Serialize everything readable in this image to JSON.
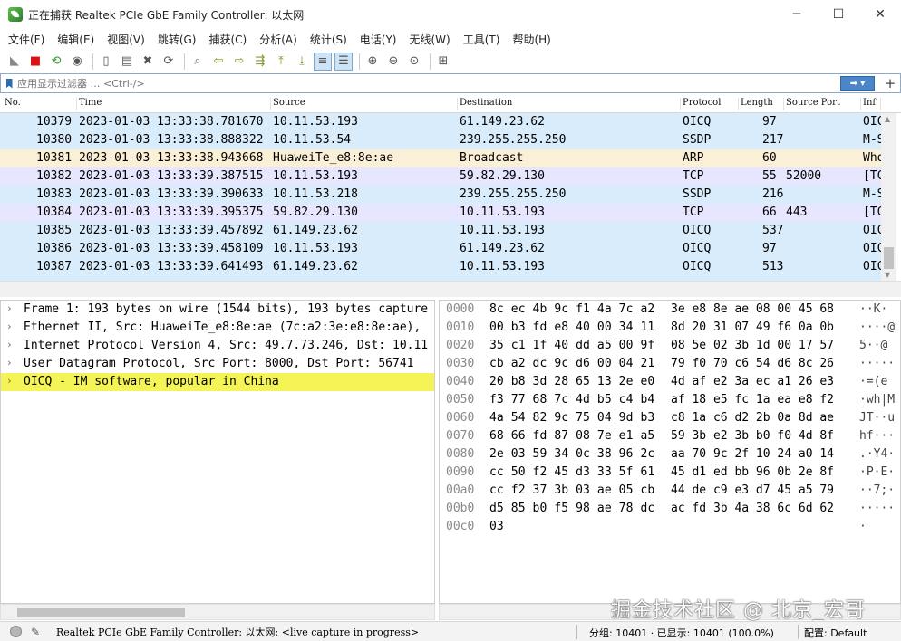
{
  "window": {
    "title": "正在捕获 Realtek PCIe GbE Family Controller: 以太网",
    "minimize": "─",
    "maximize": "☐",
    "close": "✕"
  },
  "menu": [
    "文件(F)",
    "编辑(E)",
    "视图(V)",
    "跳转(G)",
    "捕获(C)",
    "分析(A)",
    "统计(S)",
    "电话(Y)",
    "无线(W)",
    "工具(T)",
    "帮助(H)"
  ],
  "toolbar": {
    "icons": [
      "shark-fin-icon",
      "stop-icon",
      "restart-icon",
      "options-icon",
      "open-icon",
      "save-icon",
      "close-file-icon",
      "reload-icon",
      "find-icon",
      "back-icon",
      "forward-icon",
      "goto-icon",
      "first-icon",
      "last-icon",
      "autoscroll-icon",
      "colorize-icon",
      "zoom-in-icon",
      "zoom-out-icon",
      "zoom-normal-icon",
      "resize-columns-icon"
    ]
  },
  "filter": {
    "placeholder": "应用显示过滤器 … <Ctrl-/>",
    "apply": "➡ ▾",
    "add": "+"
  },
  "columns": [
    "No.",
    "Time",
    "Source",
    "Destination",
    "Protocol",
    "Length",
    "Source Port",
    "Inf"
  ],
  "packets": [
    {
      "no": "10379",
      "time": "2023-01-03 13:33:38.781670",
      "src": "10.11.53.193",
      "dst": "61.149.23.62",
      "proto": "OICQ",
      "len": "97",
      "sport": "",
      "info": "OIC",
      "color": "#d9ecfb"
    },
    {
      "no": "10380",
      "time": "2023-01-03 13:33:38.888322",
      "src": "10.11.53.54",
      "dst": "239.255.255.250",
      "proto": "SSDP",
      "len": "217",
      "sport": "",
      "info": "M-S",
      "color": "#d9ecfb"
    },
    {
      "no": "10381",
      "time": "2023-01-03 13:33:38.943668",
      "src": "HuaweiTe_e8:8e:ae",
      "dst": "Broadcast",
      "proto": "ARP",
      "len": "60",
      "sport": "",
      "info": "Who",
      "color": "#faf0d7"
    },
    {
      "no": "10382",
      "time": "2023-01-03 13:33:39.387515",
      "src": "10.11.53.193",
      "dst": "59.82.29.130",
      "proto": "TCP",
      "len": "55",
      "sport": "52000",
      "info": "[TC",
      "color": "#e7e6ff"
    },
    {
      "no": "10383",
      "time": "2023-01-03 13:33:39.390633",
      "src": "10.11.53.218",
      "dst": "239.255.255.250",
      "proto": "SSDP",
      "len": "216",
      "sport": "",
      "info": "M-S",
      "color": "#d9ecfb"
    },
    {
      "no": "10384",
      "time": "2023-01-03 13:33:39.395375",
      "src": "59.82.29.130",
      "dst": "10.11.53.193",
      "proto": "TCP",
      "len": "66",
      "sport": "443",
      "info": "[TC",
      "color": "#e7e6ff"
    },
    {
      "no": "10385",
      "time": "2023-01-03 13:33:39.457892",
      "src": "61.149.23.62",
      "dst": "10.11.53.193",
      "proto": "OICQ",
      "len": "537",
      "sport": "",
      "info": "OIC",
      "color": "#d9ecfb"
    },
    {
      "no": "10386",
      "time": "2023-01-03 13:33:39.458109",
      "src": "10.11.53.193",
      "dst": "61.149.23.62",
      "proto": "OICQ",
      "len": "97",
      "sport": "",
      "info": "OIC",
      "color": "#d9ecfb"
    },
    {
      "no": "10387",
      "time": "2023-01-03 13:33:39.641493",
      "src": "61.149.23.62",
      "dst": "10.11.53.193",
      "proto": "OICQ",
      "len": "513",
      "sport": "",
      "info": "OIC",
      "color": "#d9ecfb"
    }
  ],
  "details": [
    {
      "text": "Frame 1: 193 bytes on wire (1544 bits), 193 bytes capture",
      "hl": false
    },
    {
      "text": "Ethernet II, Src: HuaweiTe_e8:8e:ae (7c:a2:3e:e8:8e:ae),",
      "hl": false
    },
    {
      "text": "Internet Protocol Version 4, Src: 49.7.73.246, Dst: 10.11",
      "hl": false
    },
    {
      "text": "User Datagram Protocol, Src Port: 8000, Dst Port: 56741",
      "hl": false
    },
    {
      "text": "OICQ - IM software, popular in China",
      "hl": true
    }
  ],
  "hex": [
    {
      "off": "0000",
      "a": "8c ec 4b 9c f1 4a 7c a2",
      "b": "3e e8 8e ae 08 00 45 68",
      "asc": "··K·"
    },
    {
      "off": "0010",
      "a": "00 b3 fd e8 40 00 34 11",
      "b": "8d 20 31 07 49 f6 0a 0b",
      "asc": "····@"
    },
    {
      "off": "0020",
      "a": "35 c1 1f 40 dd a5 00 9f",
      "b": "08 5e 02 3b 1d 00 17 57",
      "asc": "5··@"
    },
    {
      "off": "0030",
      "a": "cb a2 dc 9c d6 00 04 21",
      "b": "79 f0 70 c6 54 d6 8c 26",
      "asc": "·····"
    },
    {
      "off": "0040",
      "a": "20 b8 3d 28 65 13 2e e0",
      "b": "4d af e2 3a ec a1 26 e3",
      "asc": " ·=(e"
    },
    {
      "off": "0050",
      "a": "f3 77 68 7c 4d b5 c4 b4",
      "b": "af 18 e5 fc 1a ea e8 f2",
      "asc": "·wh|M"
    },
    {
      "off": "0060",
      "a": "4a 54 82 9c 75 04 9d b3",
      "b": "c8 1a c6 d2 2b 0a 8d ae",
      "asc": "JT··u"
    },
    {
      "off": "0070",
      "a": "68 66 fd 87 08 7e e1 a5",
      "b": "59 3b e2 3b b0 f0 4d 8f",
      "asc": "hf···"
    },
    {
      "off": "0080",
      "a": "2e 03 59 34 0c 38 96 2c",
      "b": "aa 70 9c 2f 10 24 a0 14",
      "asc": ".·Y4·"
    },
    {
      "off": "0090",
      "a": "cc 50 f2 45 d3 33 5f 61",
      "b": "45 d1 ed bb 96 0b 2e 8f",
      "asc": "·P·E·"
    },
    {
      "off": "00a0",
      "a": "cc f2 37 3b 03 ae 05 cb",
      "b": "44 de c9 e3 d7 45 a5 79",
      "asc": "··7;·"
    },
    {
      "off": "00b0",
      "a": "d5 85 b0 f5 98 ae 78 dc",
      "b": "ac fd 3b 4a 38 6c 6d 62",
      "asc": "·····"
    },
    {
      "off": "00c0",
      "a": "03",
      "b": "",
      "asc": "·"
    }
  ],
  "status": {
    "capture": "Realtek PCIe GbE Family Controller: 以太网: <live capture in progress>",
    "packets": "分组: 10401 · 已显示: 10401 (100.0%)",
    "profile": "配置: Default"
  },
  "watermark": "掘金技术社区 @ 北京_宏哥"
}
